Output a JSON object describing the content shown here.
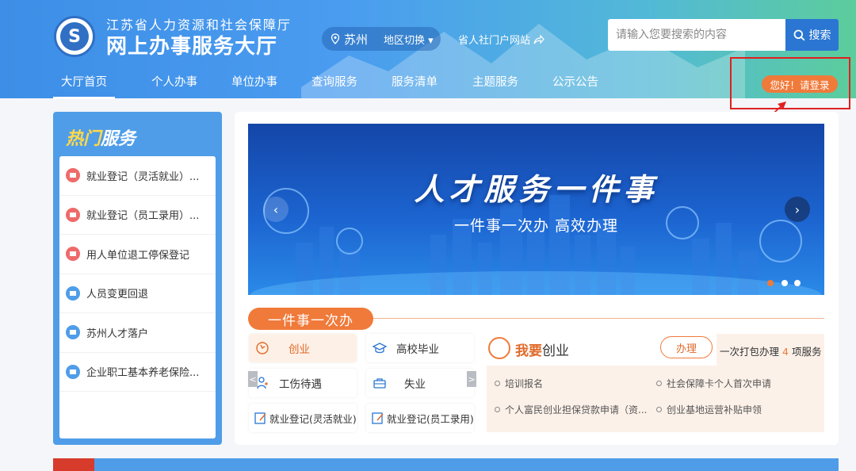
{
  "header": {
    "site_subtitle": "江苏省人力资源和社会保障厅",
    "site_title": "网上办事服务大厅",
    "city": "苏州",
    "region_switch": "地区切换",
    "portal_link": "省人社门户网站",
    "search_placeholder": "请输入您要搜索的内容",
    "search_button": "搜索",
    "login_button": "您好！请登录"
  },
  "nav": {
    "items": [
      {
        "label": "大厅首页"
      },
      {
        "label": "个人办事"
      },
      {
        "label": "单位办事"
      },
      {
        "label": "查询服务"
      },
      {
        "label": "服务清单"
      },
      {
        "label": "主题服务"
      },
      {
        "label": "公示公告"
      }
    ]
  },
  "hot": {
    "title_a": "热门",
    "title_b": "服务",
    "items": [
      {
        "label": "就业登记（灵活就业）...",
        "color": "#ef6a6a"
      },
      {
        "label": "就业登记（员工录用）...",
        "color": "#ef6a6a"
      },
      {
        "label": "用人单位退工停保登记",
        "color": "#ef6a6a"
      },
      {
        "label": "人员变更回退",
        "color": "#4f9de8"
      },
      {
        "label": "苏州人才落户",
        "color": "#4f9de8"
      },
      {
        "label": "企业职工基本养老保险...",
        "color": "#4f9de8"
      }
    ]
  },
  "banner": {
    "title": "人才服务一件事",
    "subtitle": "一件事一次办 高效办理",
    "prev": "‹",
    "next": "›"
  },
  "onething": {
    "tag": "一件事一次办",
    "services": [
      {
        "label": "创业"
      },
      {
        "label": "高校毕业"
      },
      {
        "label": "工伤待遇"
      },
      {
        "label": "失业"
      },
      {
        "label": "就业登记(灵活就业)"
      },
      {
        "label": "就业登记(员工录用)"
      }
    ],
    "scroll_left": "<",
    "scroll_right": ">"
  },
  "detail": {
    "title_a": "我要",
    "title_b": "创业",
    "handle": "办理",
    "pack_a": "一次打包办理",
    "pack_n": "4",
    "pack_b": "项服务",
    "items": [
      {
        "label": "培训报名"
      },
      {
        "label": "社会保障卡个人首次申请"
      },
      {
        "label": "个人富民创业担保贷款申请（资..."
      },
      {
        "label": "创业基地运营补贴申领"
      }
    ]
  },
  "colors": {
    "accent": "#4f9de8",
    "orange": "#f07a3a",
    "highlight_red": "#e02020"
  }
}
